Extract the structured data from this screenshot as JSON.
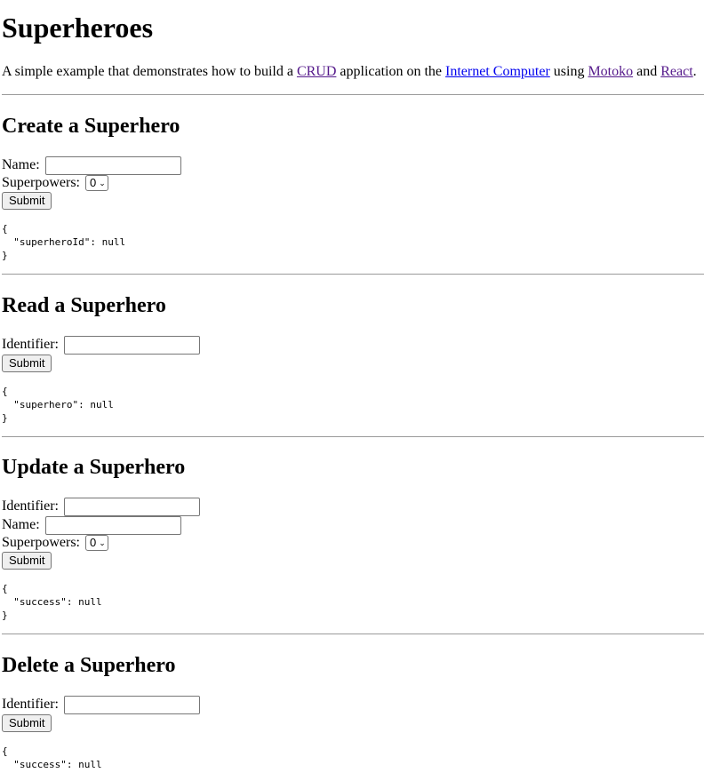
{
  "title": "Superheroes",
  "intro": {
    "text1": "A simple example that demonstrates how to build a ",
    "link_crud": "CRUD",
    "text2": " application on the ",
    "link_ic": "Internet Computer",
    "text3": " using ",
    "link_motoko": "Motoko",
    "text4": " and ",
    "link_react": "React",
    "text5": "."
  },
  "create": {
    "heading": "Create a Superhero",
    "name_label": "Name:",
    "name_value": "",
    "superpowers_label": "Superpowers:",
    "superpowers_value": "0",
    "submit_label": "Submit",
    "output": "{\n  \"superheroId\": null\n}"
  },
  "read": {
    "heading": "Read a Superhero",
    "identifier_label": "Identifier:",
    "identifier_value": "",
    "submit_label": "Submit",
    "output": "{\n  \"superhero\": null\n}"
  },
  "update": {
    "heading": "Update a Superhero",
    "identifier_label": "Identifier:",
    "identifier_value": "",
    "name_label": "Name:",
    "name_value": "",
    "superpowers_label": "Superpowers:",
    "superpowers_value": "0",
    "submit_label": "Submit",
    "output": "{\n  \"success\": null\n}"
  },
  "delete": {
    "heading": "Delete a Superhero",
    "identifier_label": "Identifier:",
    "identifier_value": "",
    "submit_label": "Submit",
    "output": "{\n  \"success\": null"
  },
  "colors": {
    "link": "#0000ee",
    "visited_link": "#551a8b",
    "rule": "#9a9a9a"
  }
}
